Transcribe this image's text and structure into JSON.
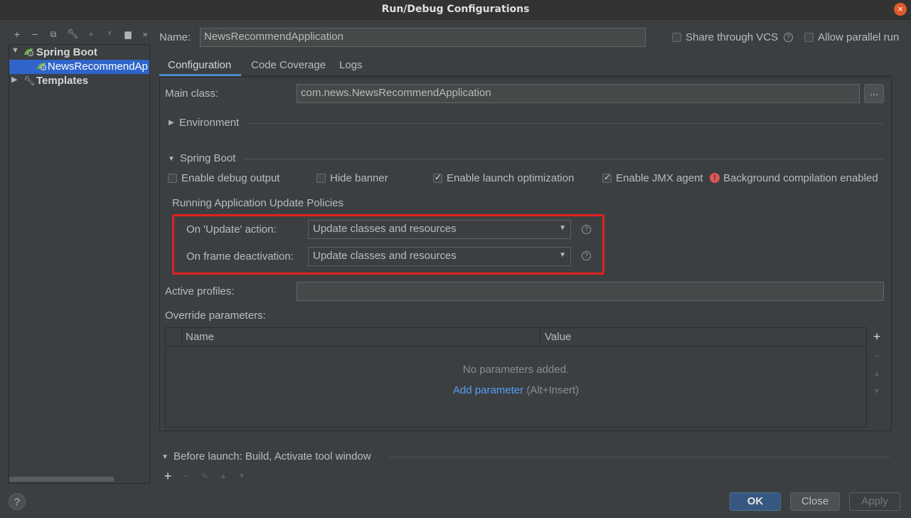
{
  "window": {
    "title": "Run/Debug Configurations"
  },
  "toolbar": {
    "icons": [
      "add-icon",
      "remove-icon",
      "copy-icon",
      "wrench-icon",
      "move-up-icon",
      "move-down-icon",
      "folder-icon",
      "more-icon"
    ]
  },
  "tree": {
    "items": [
      {
        "label": "Spring Boot",
        "expanded": true
      },
      {
        "label": "NewsRecommendAp",
        "selected": true
      },
      {
        "label": "Templates",
        "expanded": false
      }
    ]
  },
  "header": {
    "name_label": "Name:",
    "name_value": "NewsRecommendApplication",
    "share_vcs_label": "Share through VCS",
    "share_vcs_checked": false,
    "parallel_label": "Allow parallel run",
    "parallel_checked": false
  },
  "tabs": [
    "Configuration",
    "Code Coverage",
    "Logs"
  ],
  "config": {
    "main_class_label": "Main class:",
    "main_class_value": "com.news.NewsRecommendApplication",
    "browse_label": "...",
    "environment_label": "Environment",
    "spring_boot_label": "Spring Boot",
    "options": [
      {
        "label": "Enable debug output",
        "checked": false
      },
      {
        "label": "Hide banner",
        "checked": false
      },
      {
        "label": "Enable launch optimization",
        "checked": true
      },
      {
        "label": "Enable JMX agent",
        "checked": true
      }
    ],
    "warning_text": "Background compilation enabled",
    "policies_label": "Running Application Update Policies",
    "on_update_label": "On 'Update' action:",
    "on_update_value": "Update classes and resources",
    "on_frame_label": "On frame deactivation:",
    "on_frame_value": "Update classes and resources",
    "active_profiles_label": "Active profiles:",
    "active_profiles_value": "",
    "override_label": "Override parameters:",
    "table": {
      "columns": [
        "Name",
        "Value"
      ],
      "empty_text": "No parameters added.",
      "add_link": "Add parameter",
      "add_shortcut": "(Alt+Insert)"
    }
  },
  "before_launch": {
    "label": "Before launch: Build, Activate tool window"
  },
  "buttons": {
    "ok": "OK",
    "close": "Close",
    "apply": "Apply",
    "help": "?"
  },
  "colors": {
    "accent": "#2f65ca",
    "link": "#589df6",
    "highlight_box": "#e02020",
    "warning": "#e05555"
  }
}
